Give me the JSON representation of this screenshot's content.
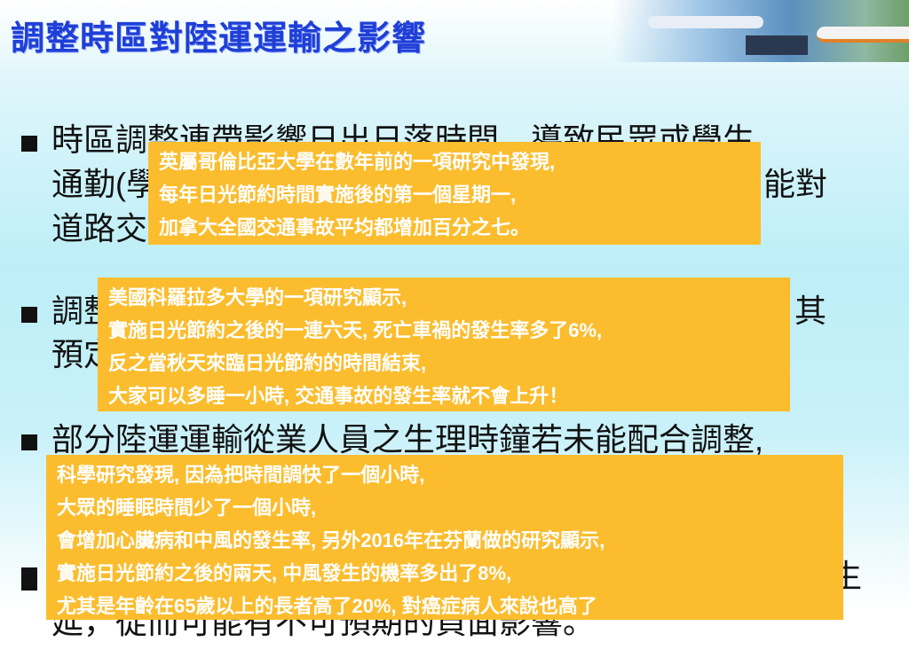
{
  "title": "調整時區對陸運運輸之影響",
  "bullets": {
    "b1_l1": "時區調整連帶影響日出日落時間，導致民眾或學生",
    "b1_l2a": "通勤(學",
    "b1_l2b": "能對",
    "b1_l3a": "道路交",
    "b2_l1a": "調整",
    "b2_l1b": "其",
    "b2_l2a": "預定",
    "b3_l1": "部分陸運運輸從業人員之生理時鐘若未能配合調整,",
    "b4_l1b": "生",
    "b4_l2": "延，從而可能有不可預期的負面影響。"
  },
  "callouts": [
    {
      "lines": [
        "英屬哥倫比亞大學在數年前的一項研究中發現,",
        "每年日光節約時間實施後的第一個星期一,",
        "加拿大全國交通事故平均都增加百分之七。"
      ]
    },
    {
      "lines": [
        "美國科羅拉多大學的一項研究顯示,",
        "實施日光節約之後的一連六天, 死亡車禍的發生率多了6%,",
        "反之當秋天來臨日光節約的時間結束,",
        "大家可以多睡一小時, 交通事故的發生率就不會上升！"
      ]
    },
    {
      "lines": [
        "科學研究發現, 因為把時間調快了一個小時,",
        "大眾的睡眠時間少了一個小時,",
        "會增加心臟病和中風的發生率, 另外2016年在芬蘭做的研究顯示,",
        "實施日光節約之後的兩天, 中風發生的機率多出了8%,",
        "尤其是年齡在65歲以上的長者高了20%, 對癌症病人來說也高了"
      ]
    }
  ],
  "colors": {
    "title": "#1f3fd6",
    "callout": "#fbbd2e"
  }
}
